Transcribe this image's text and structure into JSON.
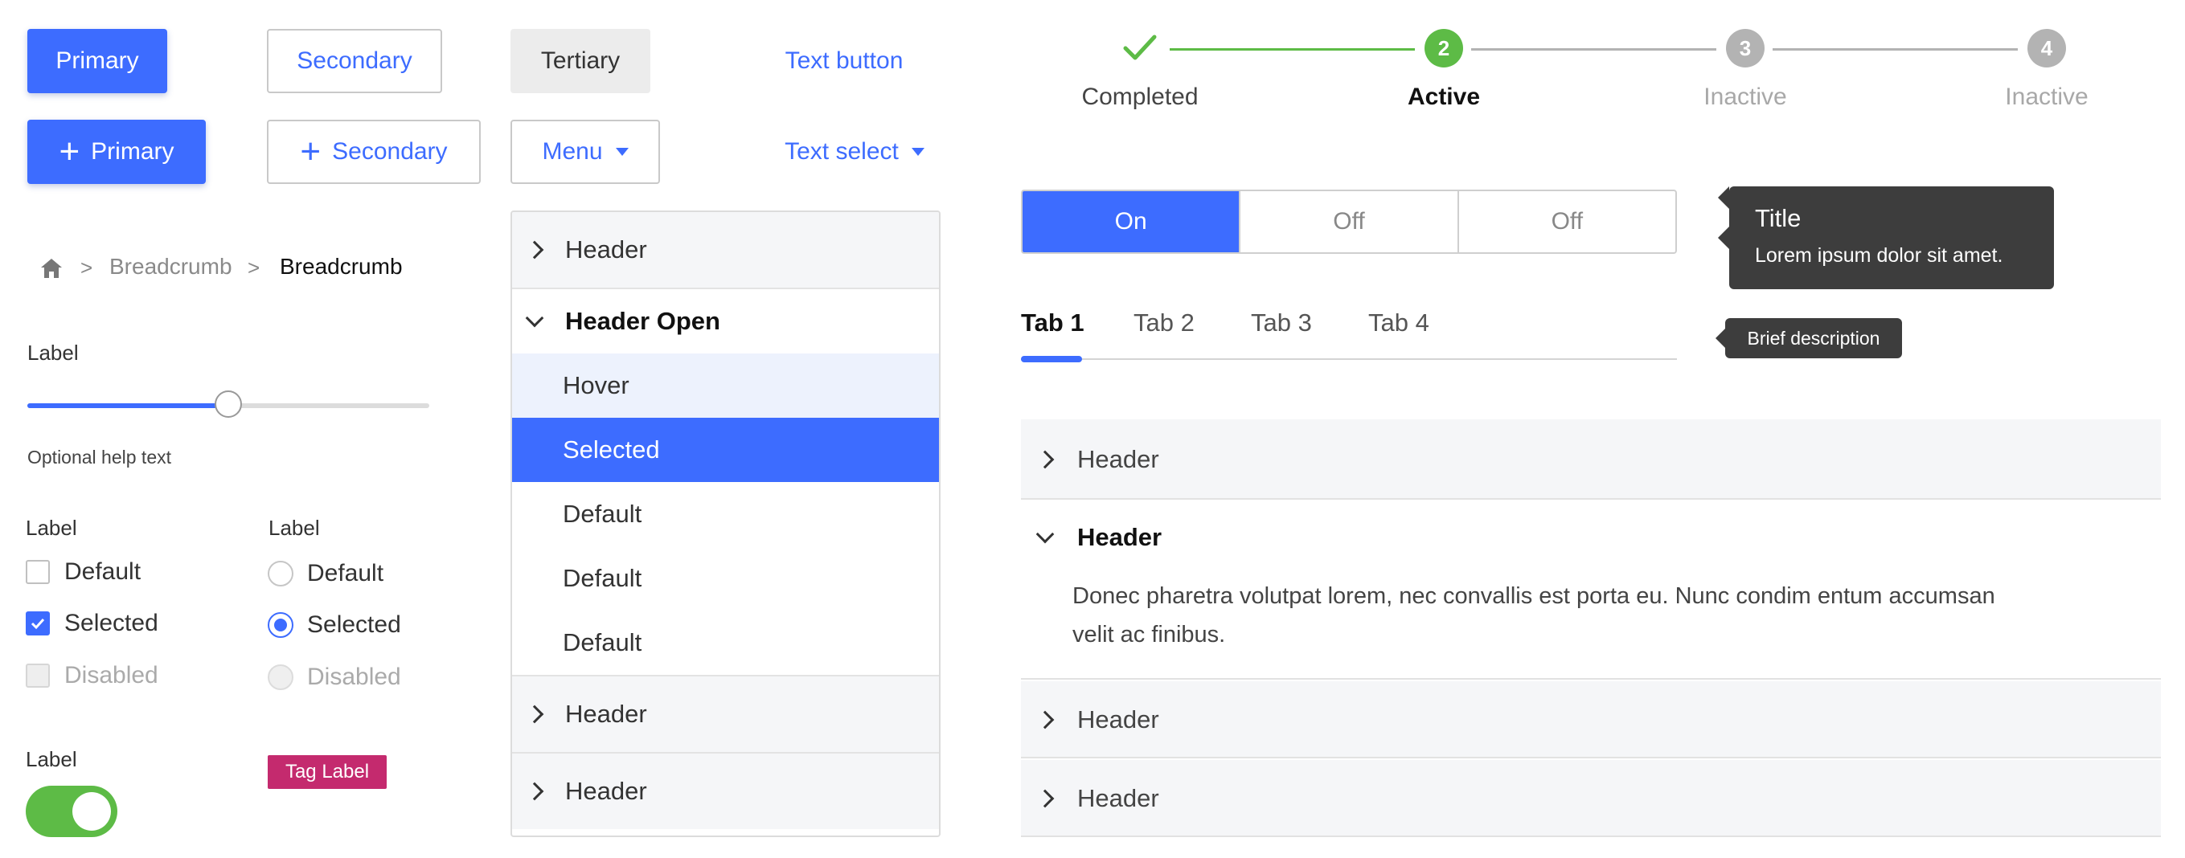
{
  "buttons": {
    "primary": "Primary",
    "secondary": "Secondary",
    "tertiary": "Tertiary",
    "text_button": "Text button",
    "primary_add": "Primary",
    "secondary_add": "Secondary",
    "menu": "Menu",
    "text_select": "Text select",
    "plus_glyph": "+"
  },
  "breadcrumb": {
    "items": [
      "Breadcrumb",
      "Breadcrumb"
    ],
    "separator": ">"
  },
  "slider": {
    "label": "Label",
    "help": "Optional help text",
    "value_fraction": 0.5
  },
  "checkboxes": {
    "label": "Label",
    "options": [
      "Default",
      "Selected",
      "Disabled"
    ]
  },
  "radios": {
    "label": "Label",
    "options": [
      "Default",
      "Selected",
      "Disabled"
    ]
  },
  "toggle": {
    "label": "Label",
    "state": "on"
  },
  "tag": {
    "text": "Tag Label",
    "color": "#c42a6e"
  },
  "menu": {
    "rows": [
      "Header",
      "Header Open",
      "Hover",
      "Selected",
      "Default",
      "Default",
      "Default",
      "Header",
      "Header"
    ]
  },
  "stepper": {
    "steps": [
      {
        "label": "Completed",
        "number": "",
        "state": "completed"
      },
      {
        "label": "Active",
        "number": "2",
        "state": "active"
      },
      {
        "label": "Inactive",
        "number": "3",
        "state": "inactive"
      },
      {
        "label": "Inactive",
        "number": "4",
        "state": "inactive"
      }
    ]
  },
  "segmented": {
    "items": [
      "On",
      "Off",
      "Off"
    ],
    "selected_index": 0
  },
  "tabs": {
    "items": [
      "Tab 1",
      "Tab 2",
      "Tab 3",
      "Tab 4"
    ],
    "selected_index": 0
  },
  "tooltip": {
    "title": "Title",
    "body": "Lorem ipsum dolor sit amet."
  },
  "tooltip_small": {
    "text": "Brief description"
  },
  "accordion": {
    "items": [
      {
        "header": "Header",
        "open": false
      },
      {
        "header": "Header",
        "open": true,
        "body_line1": "Donec pharetra volutpat lorem, nec convallis est porta eu. Nunc condim entum accumsan",
        "body_line2": "velit ac finibus."
      },
      {
        "header": "Header",
        "open": false
      },
      {
        "header": "Header",
        "open": false
      }
    ]
  },
  "colors": {
    "accent": "#3d6cff",
    "success": "#5dbb46",
    "inactive": "#b3b3b3",
    "dark": "#3d3d3d"
  },
  "icons": [
    "home-icon",
    "plus-icon",
    "caret-down-icon",
    "chevron-right-icon",
    "chevron-down-icon",
    "check-icon"
  ]
}
